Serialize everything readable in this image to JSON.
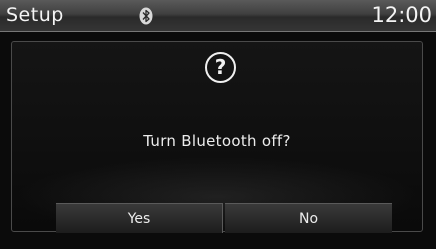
{
  "status_bar": {
    "title": "Setup",
    "bluetooth_icon": "bluetooth-icon",
    "clock": "12:00"
  },
  "dialog": {
    "icon": "question-mark-icon",
    "icon_glyph": "?",
    "message": "Turn Bluetooth off?",
    "buttons": {
      "yes_label": "Yes",
      "no_label": "No"
    }
  },
  "colors": {
    "background": "#0b0b0b",
    "text": "#ececec",
    "status_bar": "#3f3f3f"
  }
}
